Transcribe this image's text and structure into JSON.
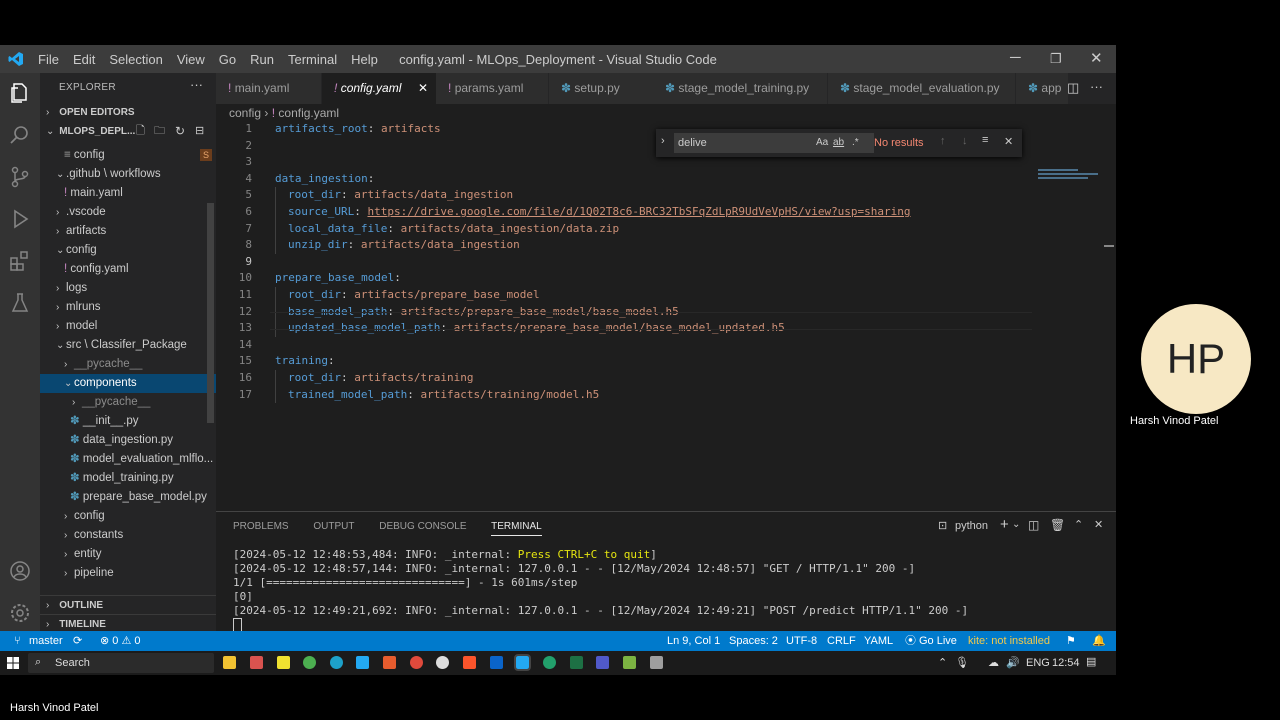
{
  "window": {
    "title": "config.yaml - MLOps_Deployment - Visual Studio Code",
    "menu": [
      "File",
      "Edit",
      "Selection",
      "View",
      "Go",
      "Run",
      "Terminal",
      "Help"
    ]
  },
  "explorer": {
    "title": "EXPLORER",
    "open_editors": "OPEN EDITORS",
    "project": "MLOPS_DEPL...",
    "items": [
      {
        "label": "config",
        "badge": "S"
      },
      {
        "label": ".github \\ workflows"
      },
      {
        "label": "main.yaml"
      },
      {
        "label": ".vscode"
      },
      {
        "label": "artifacts"
      },
      {
        "label": "config"
      },
      {
        "label": "config.yaml"
      },
      {
        "label": "logs"
      },
      {
        "label": "mlruns"
      },
      {
        "label": "model"
      },
      {
        "label": "src \\ Classifer_Package"
      },
      {
        "label": "__pycache__"
      },
      {
        "label": "components"
      },
      {
        "label": "__pycache__"
      },
      {
        "label": "__init__.py"
      },
      {
        "label": "data_ingestion.py"
      },
      {
        "label": "model_evaluation_mlflo..."
      },
      {
        "label": "model_training.py"
      },
      {
        "label": "prepare_base_model.py"
      },
      {
        "label": "config"
      },
      {
        "label": "constants"
      },
      {
        "label": "entity"
      },
      {
        "label": "pipeline"
      }
    ],
    "outline": "OUTLINE",
    "timeline": "TIMELINE"
  },
  "tabs": [
    "main.yaml",
    "config.yaml",
    "params.yaml",
    "setup.py",
    "stage_model_training.py",
    "stage_model_evaluation.py",
    "app"
  ],
  "breadcrumb": {
    "folder": "config",
    "file": "config.yaml"
  },
  "code": [
    {
      "n": "1",
      "key": "artifacts_root",
      "val": "artifacts",
      "indent": 0
    },
    {
      "n": "2",
      "key": "",
      "val": "",
      "indent": 0
    },
    {
      "n": "3",
      "key": "",
      "val": "",
      "indent": 0
    },
    {
      "n": "4",
      "key": "data_ingestion",
      "val": "",
      "indent": 0
    },
    {
      "n": "5",
      "key": "root_dir",
      "val": "artifacts/data_ingestion",
      "indent": 1
    },
    {
      "n": "6",
      "key": "source_URL",
      "val": "https://drive.google.com/file/d/1Q02T8c6-BRC32TbSFqZdLpR9UdVeVpHS/view?usp=sharing",
      "indent": 1,
      "link": true
    },
    {
      "n": "7",
      "key": "local_data_file",
      "val": "artifacts/data_ingestion/data.zip",
      "indent": 1
    },
    {
      "n": "8",
      "key": "unzip_dir",
      "val": "artifacts/data_ingestion",
      "indent": 1
    },
    {
      "n": "9",
      "key": "",
      "val": "",
      "indent": 0
    },
    {
      "n": "10",
      "key": "prepare_base_model",
      "val": "",
      "indent": 0
    },
    {
      "n": "11",
      "key": "root_dir",
      "val": "artifacts/prepare_base_model",
      "indent": 1
    },
    {
      "n": "12",
      "key": "base_model_path",
      "val": "artifacts/prepare_base_model/base_model.h5",
      "indent": 1
    },
    {
      "n": "13",
      "key": "updated_base_model_path",
      "val": "artifacts/prepare_base_model/base_model_updated.h5",
      "indent": 1
    },
    {
      "n": "14",
      "key": "",
      "val": "",
      "indent": 0
    },
    {
      "n": "15",
      "key": "training",
      "val": "",
      "indent": 0
    },
    {
      "n": "16",
      "key": "root_dir",
      "val": "artifacts/training",
      "indent": 1
    },
    {
      "n": "17",
      "key": "trained_model_path",
      "val": "artifacts/training/model.h5",
      "indent": 1
    }
  ],
  "find": {
    "query": "delive",
    "result": "No results",
    "case": "Aa",
    "word": "ab",
    "regex": ".*"
  },
  "panel": {
    "tabs": [
      "PROBLEMS",
      "OUTPUT",
      "DEBUG CONSOLE",
      "TERMINAL"
    ],
    "shell": "python",
    "lines": [
      "[2024-05-12 12:48:53,484: INFO: _internal: Press CTRL+C to quit]",
      "[2024-05-12 12:48:57,144: INFO: _internal: 127.0.0.1 - - [12/May/2024 12:48:57] \"GET / HTTP/1.1\" 200 -]",
      "1/1 [==============================] - 1s 601ms/step",
      "[0]",
      "[2024-05-12 12:49:21,692: INFO: _internal: 127.0.0.1 - - [12/May/2024 12:49:21] \"POST /predict HTTP/1.1\" 200 -]"
    ]
  },
  "status": {
    "branch": "master",
    "problems": "⊗ 0 ⚠ 0",
    "position": "Ln 9, Col 1",
    "spaces": "Spaces: 2",
    "encoding": "UTF-8",
    "eol": "CRLF",
    "lang": "YAML",
    "golive": "Go Live",
    "kite": "kite: not installed"
  },
  "taskbar": {
    "search": "Search",
    "lang": "ENG",
    "time": "12:54"
  },
  "participant": {
    "initials": "HP",
    "name": "Harsh Vinod Patel"
  },
  "colors": {
    "accent": "#007acc",
    "selection": "#094771"
  }
}
